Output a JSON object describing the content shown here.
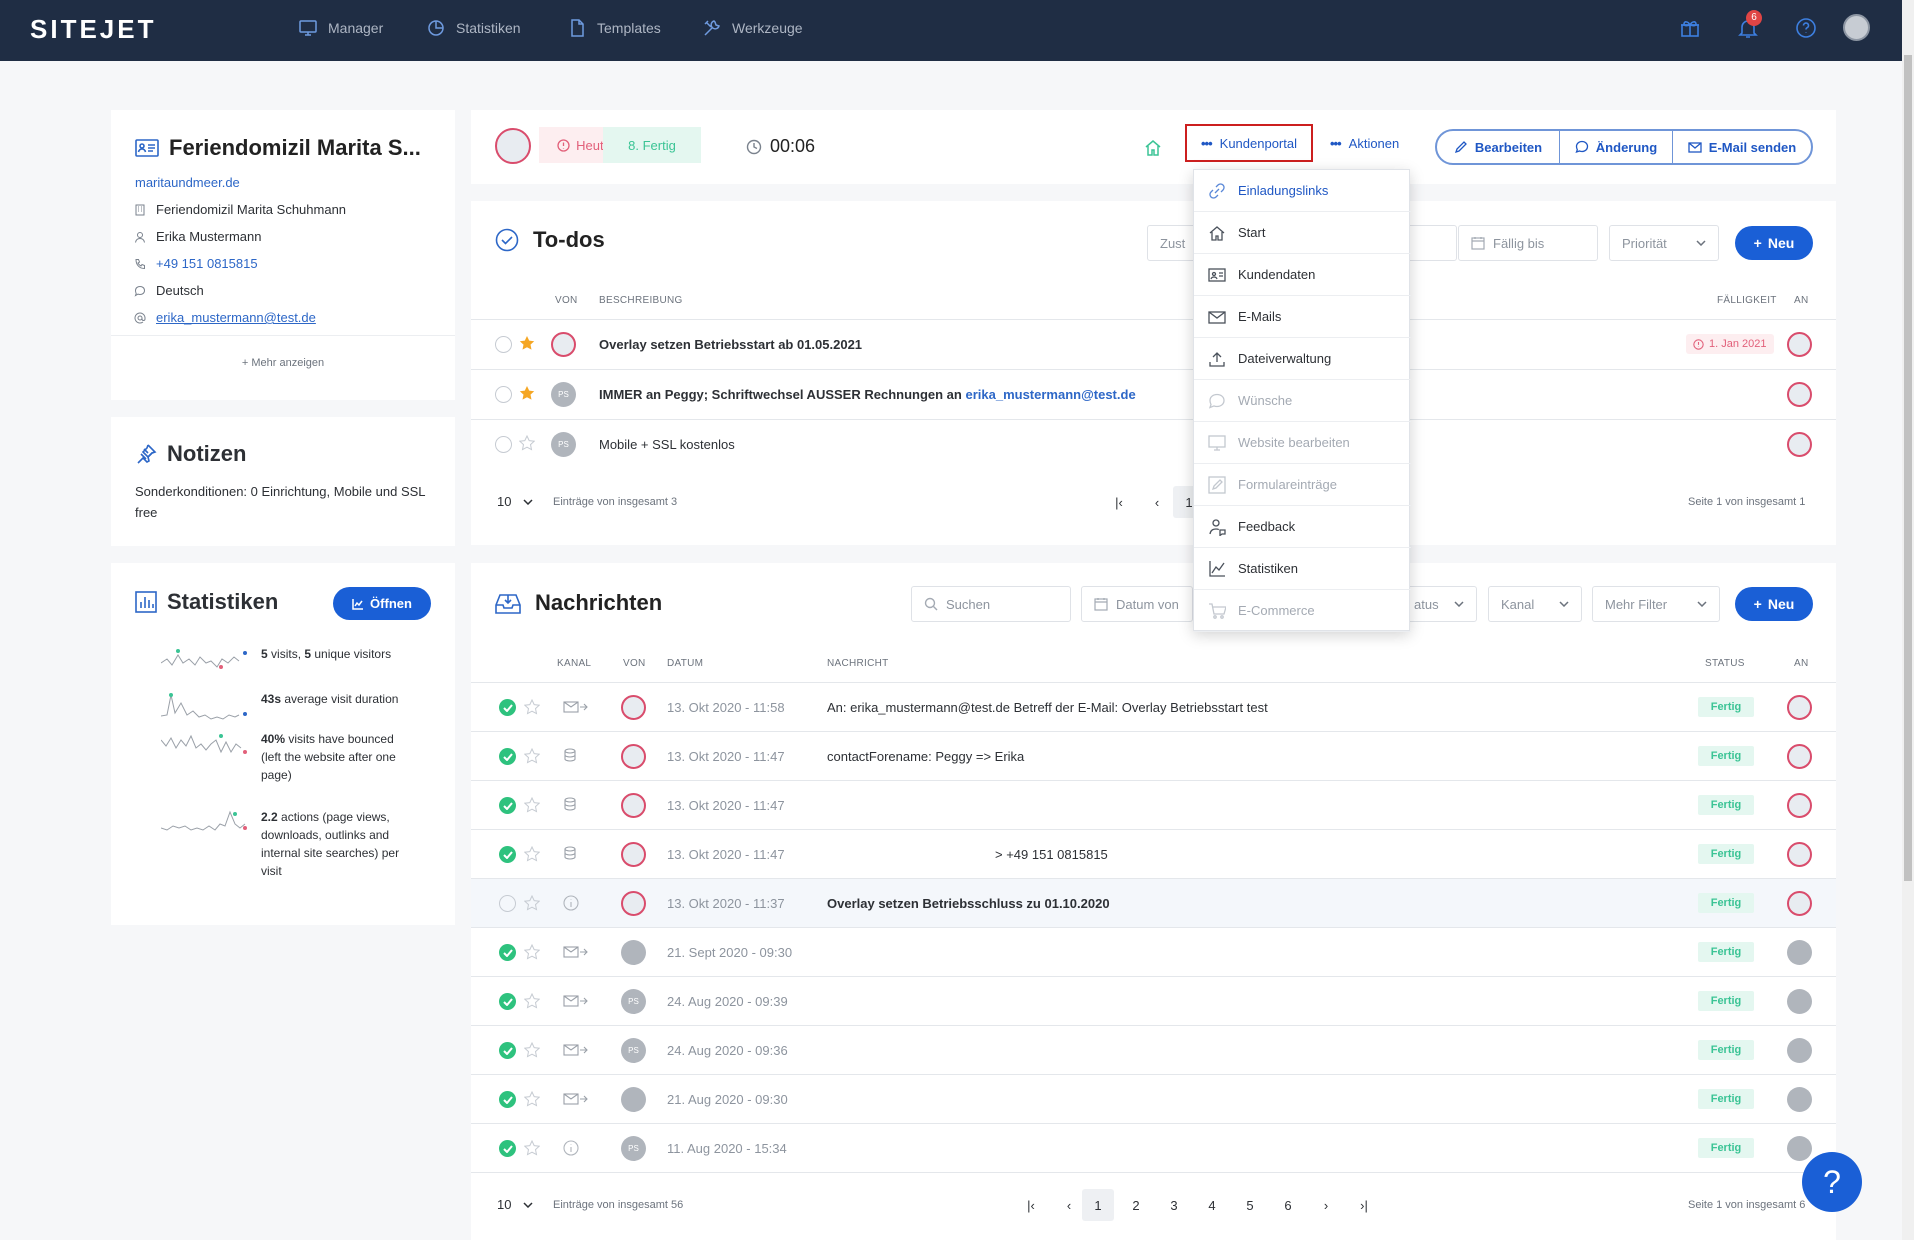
{
  "topbar": {
    "logo": "SITEJET",
    "nav": [
      "Manager",
      "Statistiken",
      "Templates",
      "Werkzeuge"
    ],
    "notification_count": "6"
  },
  "contact": {
    "name": "Feriendomizil Marita S...",
    "website": "maritaundmeer.de",
    "company": "Feriendomizil Marita Schuhmann",
    "person": "Erika Mustermann",
    "phone": "+49 151 0815815",
    "language": "Deutsch",
    "email": "erika_mustermann@test.de",
    "show_more": "+ Mehr anzeigen"
  },
  "notes": {
    "title": "Notizen",
    "text": "Sonderkonditionen: 0 Einrichtung, Mobile und SSL free"
  },
  "stats": {
    "title": "Statistiken",
    "open_label": "Öffnen",
    "rows": [
      {
        "b1": "5",
        "t1": " visits, ",
        "b2": "5",
        "t2": " unique visitors"
      },
      {
        "b1": "43s",
        "t1": " average visit duration",
        "b2": "",
        "t2": ""
      },
      {
        "b1": "40%",
        "t1": " visits have bounced (left the website after one page)",
        "b2": "",
        "t2": ""
      },
      {
        "b1": "2.2",
        "t1": " actions (page views, downloads, outlinks and internal site searches) per visit",
        "b2": "",
        "t2": ""
      }
    ]
  },
  "header": {
    "today": "Heute",
    "phase": "8. Fertig",
    "timer": "00:06",
    "portal": "Kundenportal",
    "actions": "Aktionen",
    "edit": "Bearbeiten",
    "change": "Änderung",
    "send_email": "E-Mail senden"
  },
  "todos": {
    "title": "To-dos",
    "filter_assigned": "Zust",
    "filter_due": "Fällig bis",
    "filter_priority": "Priorität",
    "new_label": "Neu",
    "col_from": "VON",
    "col_desc": "BESCHREIBUNG",
    "col_due": "FÄLLIGKEIT",
    "col_to": "AN",
    "rows": [
      {
        "text": "Overlay setzen Betriebsstart ab 01.05.2021",
        "link": "",
        "due": "1. Jan 2021",
        "starred": true,
        "from_initials": ""
      },
      {
        "text": "IMMER an Peggy; Schriftwechsel AUSSER Rechnungen an ",
        "link": "erika_mustermann@test.de",
        "due": "",
        "starred": true,
        "from_initials": "PS"
      },
      {
        "text": "Mobile + SSL kostenlos",
        "link": "",
        "due": "",
        "starred": false,
        "from_initials": "PS"
      }
    ],
    "page_size": "10",
    "total": "Einträge von insgesamt 3",
    "page": "1",
    "page_info": "Seite 1 von insgesamt 1"
  },
  "messages": {
    "title": "Nachrichten",
    "search_placeholder": "Suchen",
    "filter_date": "Datum von",
    "filter_status": "atus",
    "filter_channel": "Kanal",
    "filter_more": "Mehr Filter",
    "new_label": "Neu",
    "col_channel": "KANAL",
    "col_from": "VON",
    "col_date": "DATUM",
    "col_message": "NACHRICHT",
    "col_status": "STATUS",
    "col_to": "AN",
    "rows": [
      {
        "date": "13. Okt 2020 - 11:58",
        "text": "An: erika_mustermann@test.de Betreff der E-Mail: Overlay Betriebsstart test",
        "status": "Fertig",
        "channel": "email",
        "from": "avatar",
        "done": true,
        "bold": false
      },
      {
        "date": "13. Okt 2020 - 11:47",
        "text": "contactForename: Peggy => Erika",
        "status": "Fertig",
        "channel": "db",
        "from": "avatar",
        "done": true,
        "bold": false
      },
      {
        "date": "13. Okt 2020 - 11:47",
        "text": "",
        "status": "Fertig",
        "channel": "db",
        "from": "avatar",
        "done": true,
        "bold": false
      },
      {
        "date": "13. Okt 2020 - 11:47",
        "text": "> +49 151 0815815",
        "status": "Fertig",
        "channel": "db",
        "from": "avatar",
        "done": true,
        "bold": false
      },
      {
        "date": "13. Okt 2020 - 11:37",
        "text": "Overlay setzen Betriebsschluss zu 01.10.2020",
        "status": "Fertig",
        "channel": "info",
        "from": "avatar",
        "done": false,
        "bold": true
      },
      {
        "date": "21. Sept 2020 - 09:30",
        "text": "",
        "status": "Fertig",
        "channel": "email",
        "from": "grey",
        "done": true,
        "bold": false
      },
      {
        "date": "24. Aug 2020 - 09:39",
        "text": "",
        "status": "Fertig",
        "channel": "email",
        "from": "PS",
        "done": true,
        "bold": false
      },
      {
        "date": "24. Aug 2020 - 09:36",
        "text": "",
        "status": "Fertig",
        "channel": "email",
        "from": "PS",
        "done": true,
        "bold": false
      },
      {
        "date": "21. Aug 2020 - 09:30",
        "text": "",
        "status": "Fertig",
        "channel": "email",
        "from": "grey",
        "done": true,
        "bold": false
      },
      {
        "date": "11. Aug 2020 - 15:34",
        "text": "",
        "status": "Fertig",
        "channel": "info",
        "from": "PS",
        "done": true,
        "bold": false
      }
    ],
    "page_size": "10",
    "total": "Einträge von insgesamt 56",
    "pages": [
      "1",
      "2",
      "3",
      "4",
      "5",
      "6"
    ],
    "page_info": "Seite 1 von insgesamt 6"
  },
  "dropdown": {
    "items": [
      {
        "label": "Einladungslinks",
        "icon": "link-icon",
        "disabled": false
      },
      {
        "label": "Start",
        "icon": "home-icon",
        "disabled": false
      },
      {
        "label": "Kundendaten",
        "icon": "id-card-icon",
        "disabled": false
      },
      {
        "label": "E-Mails",
        "icon": "mail-icon",
        "disabled": false
      },
      {
        "label": "Dateiverwaltung",
        "icon": "upload-icon",
        "disabled": false
      },
      {
        "label": "Wünsche",
        "icon": "chat-icon",
        "disabled": true
      },
      {
        "label": "Website bearbeiten",
        "icon": "monitor-icon",
        "disabled": true
      },
      {
        "label": "Formulareinträge",
        "icon": "pencil-icon",
        "disabled": true
      },
      {
        "label": "Feedback",
        "icon": "user-feedback-icon",
        "disabled": false
      },
      {
        "label": "Statistiken",
        "icon": "chart-icon",
        "disabled": false
      },
      {
        "label": "E-Commerce",
        "icon": "cart-icon",
        "disabled": true
      }
    ]
  },
  "help": {
    "label": "?"
  },
  "colors": {
    "nav": "#1f2d44",
    "accent": "#1a5fd6",
    "success": "#2ec27e",
    "danger": "#e2607a"
  }
}
